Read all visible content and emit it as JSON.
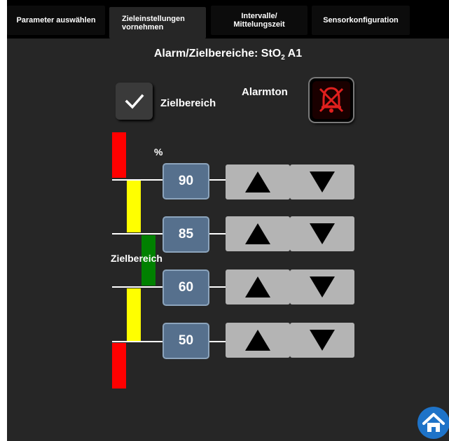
{
  "tabs": [
    {
      "label": "Parameter auswählen"
    },
    {
      "label": "Zieleinstellungen vornehmen"
    },
    {
      "label": "Intervalle/ Mittelungszeit"
    },
    {
      "label": "Sensorkonfiguration"
    }
  ],
  "active_tab": "Zieleinstellungen vornehmen",
  "title": {
    "main": "Alarm/Zielbereiche: StO",
    "subscript": "2",
    "suffix": " A1"
  },
  "target_range": {
    "label": "Zielbereich",
    "checked": true
  },
  "alarm_tone": {
    "label": "Alarmton",
    "muted": true
  },
  "unit": "%",
  "zone_label": "Zielbereich",
  "thresholds": [
    {
      "value": "90"
    },
    {
      "value": "85"
    },
    {
      "value": "60"
    },
    {
      "value": "50"
    }
  ],
  "zone_colors": {
    "alarm": "#ff0000",
    "warning": "#ffff00",
    "target": "#008000"
  },
  "colors": {
    "background": "#262626",
    "value_box": "#56708d",
    "arrow_button": "#b4b4b4",
    "home": "#1e73c8"
  },
  "icons": [
    "check-icon",
    "alarm-off-icon",
    "arrow-up-icon",
    "arrow-down-icon",
    "home-icon"
  ]
}
